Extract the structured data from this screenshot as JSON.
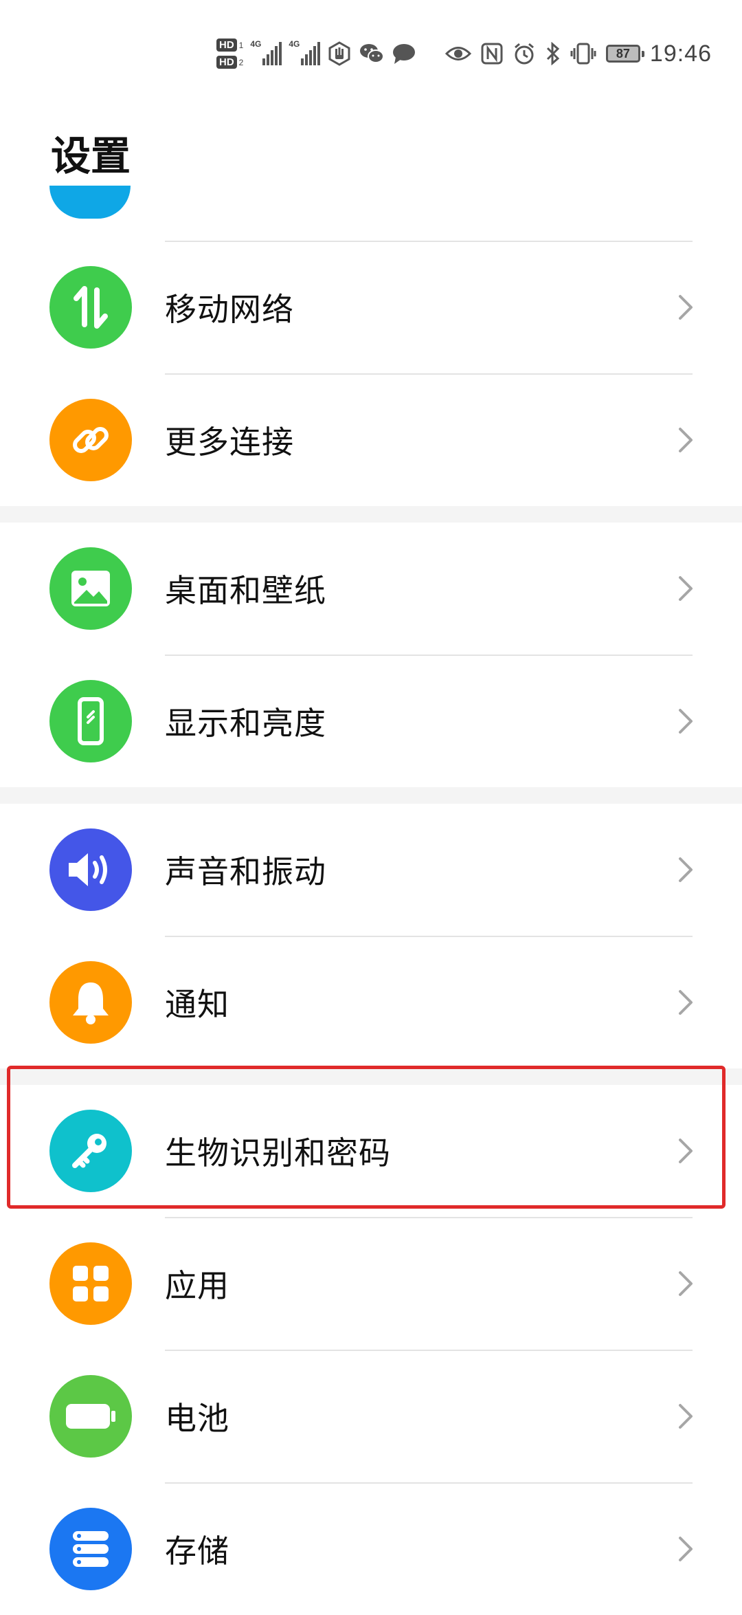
{
  "status_bar": {
    "hd1": "HD",
    "hd1_sub": "1",
    "hd2": "HD",
    "hd2_sub": "2",
    "net1": "4G",
    "net2": "4G",
    "battery": "87",
    "time": "19:46"
  },
  "page": {
    "title": "设置"
  },
  "settings": [
    {
      "label": "移动网络",
      "icon": "mobile-data-icon",
      "color": "#3fcc4d"
    },
    {
      "label": "更多连接",
      "icon": "link-icon",
      "color": "#ff9900"
    },
    {
      "label": "桌面和壁纸",
      "icon": "image-icon",
      "color": "#3fcc4d"
    },
    {
      "label": "显示和亮度",
      "icon": "phone-display-icon",
      "color": "#3fcc4d"
    },
    {
      "label": "声音和振动",
      "icon": "speaker-icon",
      "color": "#4456e8"
    },
    {
      "label": "通知",
      "icon": "bell-icon",
      "color": "#ff9900"
    },
    {
      "label": "生物识别和密码",
      "icon": "key-icon",
      "color": "#0fc1cc"
    },
    {
      "label": "应用",
      "icon": "apps-grid-icon",
      "color": "#ff9900"
    },
    {
      "label": "电池",
      "icon": "battery-icon",
      "color": "#5cc846"
    },
    {
      "label": "存储",
      "icon": "storage-icon",
      "color": "#1b77f2"
    }
  ],
  "colors": {
    "accent_highlight": "#e02a2a",
    "chevron": "#a6a6a6",
    "divider": "#e3e3e3",
    "section_gap": "#f4f4f4"
  }
}
